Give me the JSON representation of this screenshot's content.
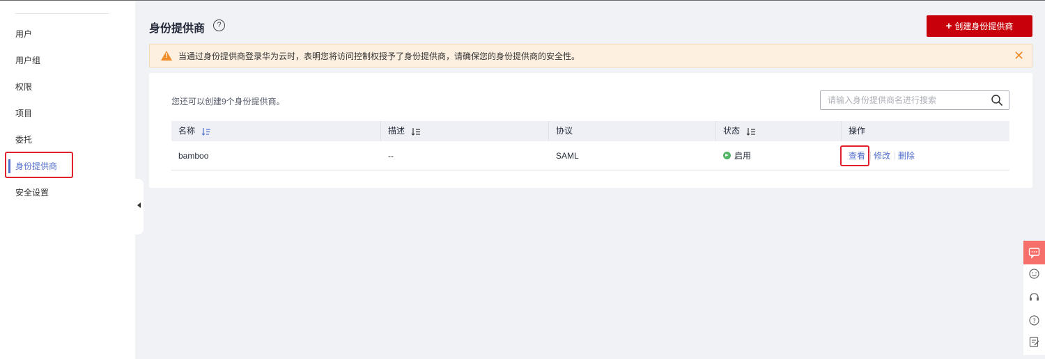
{
  "sidebar": {
    "items": [
      {
        "label": "用户"
      },
      {
        "label": "用户组"
      },
      {
        "label": "权限"
      },
      {
        "label": "项目"
      },
      {
        "label": "委托"
      },
      {
        "label": "身份提供商"
      },
      {
        "label": "安全设置"
      }
    ],
    "active_index": 5
  },
  "header": {
    "title": "身份提供商",
    "help_icon": "question-circle-icon",
    "create_button": "创建身份提供商"
  },
  "alert": {
    "text": "当通过身份提供商登录华为云时，表明您将访问控制权授予了身份提供商，请确保您的身份提供商的安全性。",
    "icon": "warning-icon"
  },
  "main": {
    "quota_text": "您还可以创建9个身份提供商。",
    "search": {
      "placeholder": "请输入身份提供商名进行搜索"
    },
    "table": {
      "columns": [
        "名称",
        "描述",
        "协议",
        "状态",
        "操作"
      ],
      "rows": [
        {
          "name": "bamboo",
          "description": "--",
          "protocol": "SAML",
          "status": "启用",
          "actions": [
            "查看",
            "修改",
            "删除"
          ]
        }
      ]
    }
  },
  "float_panel": {
    "icons": [
      "chat-icon",
      "smile-icon",
      "headset-icon",
      "help-icon",
      "feedback-icon"
    ]
  },
  "colors": {
    "brand_red": "#c7000b",
    "link_blue": "#526ecc",
    "status_green": "#50b464",
    "warning_orange": "#f08c28",
    "highlight_red": "#e0202a"
  }
}
